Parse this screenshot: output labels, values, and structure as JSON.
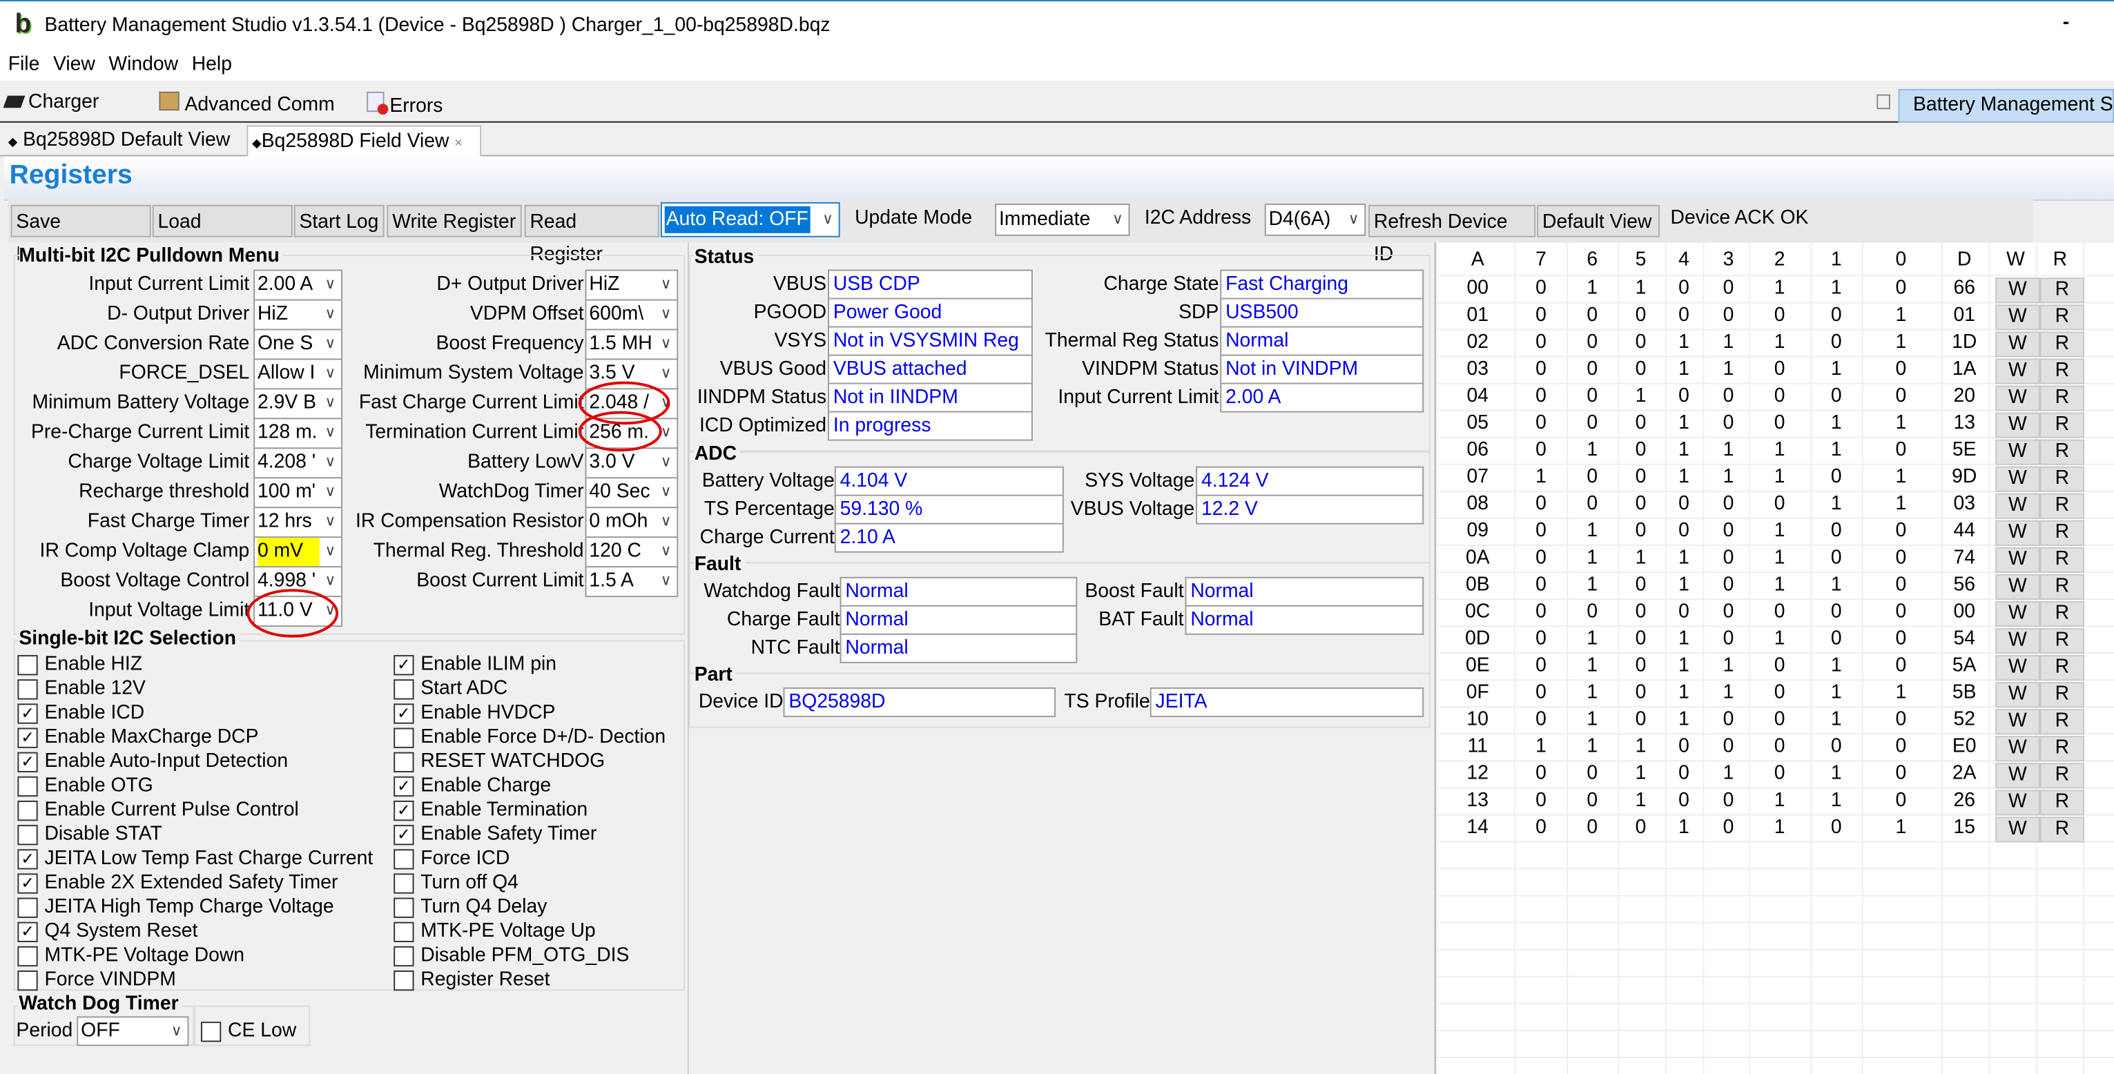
{
  "window": {
    "title": "Battery Management Studio v1.3.54.1  (Device -  Bq25898D )  Charger_1_00-bq25898D.bqz",
    "minimize": "-"
  },
  "menu": [
    "File",
    "View",
    "Window",
    "Help"
  ],
  "perspectives": [
    {
      "label": "Charger",
      "icon": "chip-icon"
    },
    {
      "label": "Advanced Comm",
      "icon": "toolbox-icon"
    },
    {
      "label": "Errors",
      "icon": "error-log-icon"
    }
  ],
  "perspective_right": "Battery Management S",
  "tabs": [
    {
      "label": "Bq25898D  Default View",
      "active": false
    },
    {
      "label": "Bq25898D  Field View",
      "active": true,
      "close": "×"
    }
  ],
  "page_title": "Registers",
  "toolbar": {
    "save": "Save Registers",
    "load": "Load Registers",
    "start_log": "Start Log",
    "write": "Write Register",
    "read": "Read Register",
    "auto_read": "Auto Read: OFF",
    "update_mode_label": "Update Mode",
    "update_mode": "Immediate",
    "i2c_label": "I2C Address",
    "i2c": "D4(6A)",
    "refresh": "Refresh Device ID",
    "default_view": "Default View",
    "ack": "Device ACK OK"
  },
  "multibit": {
    "title": "Multi-bit I2C Pulldown Menu",
    "left": [
      {
        "label": "Input Current Limit",
        "value": "2.00 A"
      },
      {
        "label": "D- Output Driver",
        "value": "HiZ"
      },
      {
        "label": "ADC Conversion Rate",
        "value": "One S"
      },
      {
        "label": "FORCE_DSEL",
        "value": "Allow I"
      },
      {
        "label": "Minimum Battery Voltage",
        "value": "2.9V B"
      },
      {
        "label": "Pre-Charge Current Limit",
        "value": "128 m."
      },
      {
        "label": "Charge Voltage Limit",
        "value": "4.208 '"
      },
      {
        "label": "Recharge threshold",
        "value": "100 m'"
      },
      {
        "label": "Fast Charge Timer",
        "value": "12 hrs"
      },
      {
        "label": "IR Comp Voltage Clamp",
        "value": "0 mV",
        "highlight": "#ffff00"
      },
      {
        "label": "Boost Voltage Control",
        "value": "4.998 '"
      },
      {
        "label": "Input Voltage Limit",
        "value": "11.0 V"
      }
    ],
    "right": [
      {
        "label": "D+ Output Driver",
        "value": "HiZ"
      },
      {
        "label": "VDPM Offset",
        "value": "600m\\"
      },
      {
        "label": "Boost Frequency",
        "value": "1.5 MH"
      },
      {
        "label": "Minimum System Voltage",
        "value": "3.5 V"
      },
      {
        "label": "Fast Charge Current Limit",
        "value": "2.048 /"
      },
      {
        "label": "Termination Current Limit",
        "value": "256 m."
      },
      {
        "label": "Battery LowV",
        "value": "3.0 V"
      },
      {
        "label": "WatchDog Timer",
        "value": "40 Sec"
      },
      {
        "label": "IR Compensation Resistor",
        "value": "0 mOh"
      },
      {
        "label": "Thermal Reg. Threshold",
        "value": "120 C"
      },
      {
        "label": "Boost Current Limit",
        "value": "1.5 A"
      }
    ]
  },
  "singlebit": {
    "title": "Single-bit I2C Selection",
    "left": [
      {
        "label": "Enable HIZ",
        "checked": false
      },
      {
        "label": "Enable 12V",
        "checked": false
      },
      {
        "label": "Enable ICD",
        "checked": true
      },
      {
        "label": "Enable MaxCharge DCP",
        "checked": true
      },
      {
        "label": "Enable Auto-Input Detection",
        "checked": true
      },
      {
        "label": "Enable OTG",
        "checked": false
      },
      {
        "label": "Enable Current Pulse Control",
        "checked": false
      },
      {
        "label": "Disable STAT",
        "checked": false
      },
      {
        "label": "JEITA Low Temp Fast Charge Current",
        "checked": true
      },
      {
        "label": "Enable 2X Extended Safety Timer",
        "checked": true
      },
      {
        "label": "JEITA High Temp Charge Voltage",
        "checked": false
      },
      {
        "label": "Q4 System Reset",
        "checked": true
      },
      {
        "label": "MTK-PE Voltage Down",
        "checked": false
      },
      {
        "label": "Force VINDPM",
        "checked": false
      }
    ],
    "right": [
      {
        "label": "Enable ILIM pin",
        "checked": true
      },
      {
        "label": "Start ADC",
        "checked": false
      },
      {
        "label": "Enable HVDCP",
        "checked": true
      },
      {
        "label": "Enable Force D+/D- Dection",
        "checked": false
      },
      {
        "label": "RESET WATCHDOG",
        "checked": false
      },
      {
        "label": "Enable Charge",
        "checked": true
      },
      {
        "label": "Enable Termination",
        "checked": true
      },
      {
        "label": "Enable Safety Timer",
        "checked": true
      },
      {
        "label": "Force ICD",
        "checked": false
      },
      {
        "label": "Turn off Q4",
        "checked": false
      },
      {
        "label": "Turn Q4 Delay",
        "checked": false
      },
      {
        "label": "MTK-PE Voltage Up",
        "checked": false
      },
      {
        "label": "Disable PFM_OTG_DIS",
        "checked": false
      },
      {
        "label": "Register Reset",
        "checked": false
      }
    ]
  },
  "watchdog": {
    "title": "Watch Dog Timer",
    "period_label": "Period",
    "period": "OFF",
    "ce_low": "CE Low",
    "ce_low_checked": false
  },
  "status": {
    "title": "Status",
    "left": [
      {
        "label": "VBUS",
        "value": "USB CDP"
      },
      {
        "label": "PGOOD",
        "value": "Power Good"
      },
      {
        "label": "VSYS",
        "value": "Not in VSYSMIN Reg"
      },
      {
        "label": "VBUS Good",
        "value": "VBUS attached"
      },
      {
        "label": "IINDPM Status",
        "value": "Not in IINDPM"
      },
      {
        "label": "ICD Optimized",
        "value": "In progress"
      }
    ],
    "right": [
      {
        "label": "Charge State",
        "value": "Fast Charging"
      },
      {
        "label": "SDP",
        "value": "USB500"
      },
      {
        "label": "Thermal Reg Status",
        "value": "Normal"
      },
      {
        "label": "VINDPM Status",
        "value": "Not in VINDPM"
      },
      {
        "label": "Input Current Limit",
        "value": "2.00 A"
      }
    ]
  },
  "adc": {
    "title": "ADC",
    "left": [
      {
        "label": "Battery Voltage",
        "value": "4.104 V"
      },
      {
        "label": "TS Percentage",
        "value": "59.130 %"
      },
      {
        "label": "Charge Current",
        "value": "2.10 A"
      }
    ],
    "right": [
      {
        "label": "SYS Voltage",
        "value": "4.124 V"
      },
      {
        "label": "VBUS Voltage",
        "value": "12.2 V"
      }
    ]
  },
  "fault": {
    "title": "Fault",
    "left": [
      {
        "label": "Watchdog Fault",
        "value": "Normal"
      },
      {
        "label": "Charge Fault",
        "value": "Normal"
      },
      {
        "label": "NTC Fault",
        "value": "Normal"
      }
    ],
    "right": [
      {
        "label": "Boost Fault",
        "value": "Normal"
      },
      {
        "label": "BAT Fault",
        "value": "Normal"
      }
    ]
  },
  "part": {
    "title": "Part",
    "left": [
      {
        "label": "Device ID",
        "value": "BQ25898D"
      }
    ],
    "right": [
      {
        "label": "TS Profile",
        "value": "JEITA"
      }
    ]
  },
  "registers": {
    "columns": [
      "A",
      "7",
      "6",
      "5",
      "4",
      "3",
      "2",
      "1",
      "0",
      "D",
      "W",
      "R"
    ],
    "write_label": "W",
    "read_label": "R",
    "rows": [
      {
        "addr": "00",
        "bits": [
          "0",
          "1",
          "1",
          "0",
          "0",
          "1",
          "1",
          "0"
        ],
        "hex": "66"
      },
      {
        "addr": "01",
        "bits": [
          "0",
          "0",
          "0",
          "0",
          "0",
          "0",
          "0",
          "1"
        ],
        "hex": "01"
      },
      {
        "addr": "02",
        "bits": [
          "0",
          "0",
          "0",
          "1",
          "1",
          "1",
          "0",
          "1"
        ],
        "hex": "1D"
      },
      {
        "addr": "03",
        "bits": [
          "0",
          "0",
          "0",
          "1",
          "1",
          "0",
          "1",
          "0"
        ],
        "hex": "1A"
      },
      {
        "addr": "04",
        "bits": [
          "0",
          "0",
          "1",
          "0",
          "0",
          "0",
          "0",
          "0"
        ],
        "hex": "20"
      },
      {
        "addr": "05",
        "bits": [
          "0",
          "0",
          "0",
          "1",
          "0",
          "0",
          "1",
          "1"
        ],
        "hex": "13"
      },
      {
        "addr": "06",
        "bits": [
          "0",
          "1",
          "0",
          "1",
          "1",
          "1",
          "1",
          "0"
        ],
        "hex": "5E"
      },
      {
        "addr": "07",
        "bits": [
          "1",
          "0",
          "0",
          "1",
          "1",
          "1",
          "0",
          "1"
        ],
        "hex": "9D"
      },
      {
        "addr": "08",
        "bits": [
          "0",
          "0",
          "0",
          "0",
          "0",
          "0",
          "1",
          "1"
        ],
        "hex": "03"
      },
      {
        "addr": "09",
        "bits": [
          "0",
          "1",
          "0",
          "0",
          "0",
          "1",
          "0",
          "0"
        ],
        "hex": "44"
      },
      {
        "addr": "0A",
        "bits": [
          "0",
          "1",
          "1",
          "1",
          "0",
          "1",
          "0",
          "0"
        ],
        "hex": "74"
      },
      {
        "addr": "0B",
        "bits": [
          "0",
          "1",
          "0",
          "1",
          "0",
          "1",
          "1",
          "0"
        ],
        "hex": "56"
      },
      {
        "addr": "0C",
        "bits": [
          "0",
          "0",
          "0",
          "0",
          "0",
          "0",
          "0",
          "0"
        ],
        "hex": "00"
      },
      {
        "addr": "0D",
        "bits": [
          "0",
          "1",
          "0",
          "1",
          "0",
          "1",
          "0",
          "0"
        ],
        "hex": "54"
      },
      {
        "addr": "0E",
        "bits": [
          "0",
          "1",
          "0",
          "1",
          "1",
          "0",
          "1",
          "0"
        ],
        "hex": "5A"
      },
      {
        "addr": "0F",
        "bits": [
          "0",
          "1",
          "0",
          "1",
          "1",
          "0",
          "1",
          "1"
        ],
        "hex": "5B"
      },
      {
        "addr": "10",
        "bits": [
          "0",
          "1",
          "0",
          "1",
          "0",
          "0",
          "1",
          "0"
        ],
        "hex": "52"
      },
      {
        "addr": "11",
        "bits": [
          "1",
          "1",
          "1",
          "0",
          "0",
          "0",
          "0",
          "0"
        ],
        "hex": "E0"
      },
      {
        "addr": "12",
        "bits": [
          "0",
          "0",
          "1",
          "0",
          "1",
          "0",
          "1",
          "0"
        ],
        "hex": "2A"
      },
      {
        "addr": "13",
        "bits": [
          "0",
          "0",
          "1",
          "0",
          "0",
          "1",
          "1",
          "0"
        ],
        "hex": "26"
      },
      {
        "addr": "14",
        "bits": [
          "0",
          "0",
          "0",
          "1",
          "0",
          "1",
          "0",
          "1"
        ],
        "hex": "15"
      }
    ]
  },
  "colors": {
    "accent": "#1a7fd5",
    "value_text": "#0000ee",
    "highlight": "#ffff00",
    "annotation": "#e00000"
  }
}
